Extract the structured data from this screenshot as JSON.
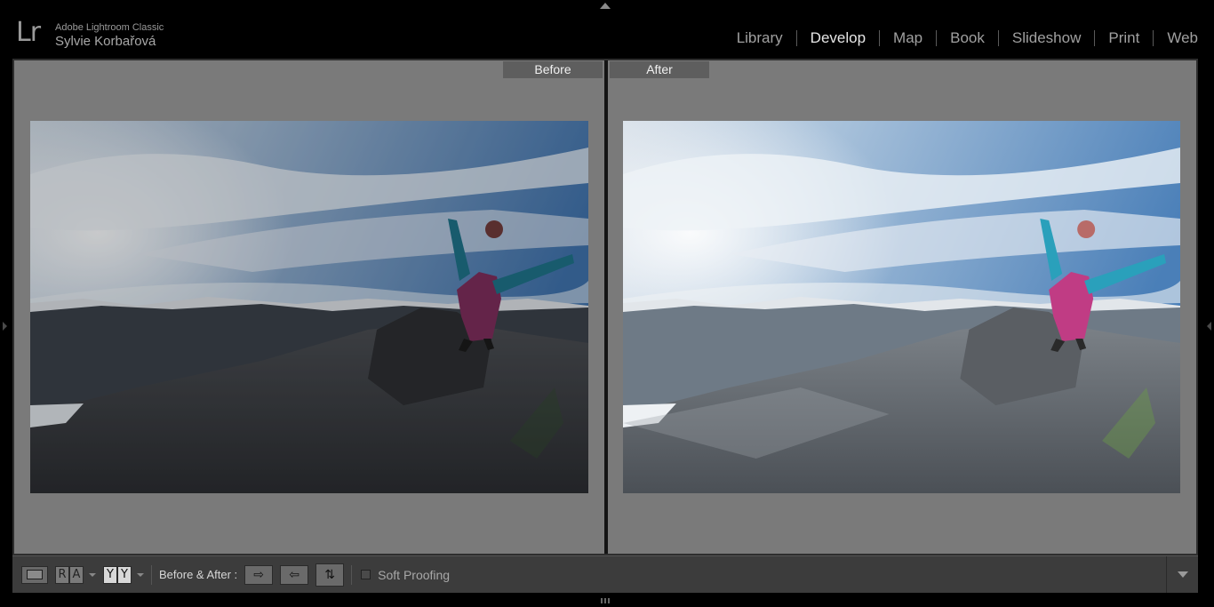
{
  "app": {
    "logo_text": "Lr",
    "app_name": "Adobe Lightroom Classic",
    "user_name": "Sylvie Korbařová"
  },
  "modules": [
    {
      "label": "Library",
      "active": false
    },
    {
      "label": "Develop",
      "active": true
    },
    {
      "label": "Map",
      "active": false
    },
    {
      "label": "Book",
      "active": false
    },
    {
      "label": "Slideshow",
      "active": false
    },
    {
      "label": "Print",
      "active": false
    },
    {
      "label": "Web",
      "active": false
    }
  ],
  "view": {
    "before_label": "Before",
    "after_label": "After"
  },
  "toolbar": {
    "view_mode_icon": "loupe-view-icon",
    "ra_left": "R",
    "ra_right": "A",
    "yy_left": "Y",
    "yy_right": "Y",
    "before_after_label": "Before & After :",
    "copy_before_to_after_icon": "arrow-right-icon",
    "copy_after_to_before_icon": "arrow-left-icon",
    "swap_icon": "swap-icon",
    "soft_proofing_label": "Soft Proofing",
    "soft_proofing_checked": false
  },
  "colors": {
    "background": "#000000",
    "canvas": "#7a7a7a",
    "toolbar": "#3c3c3c",
    "active_module": "#e6e6e6"
  }
}
